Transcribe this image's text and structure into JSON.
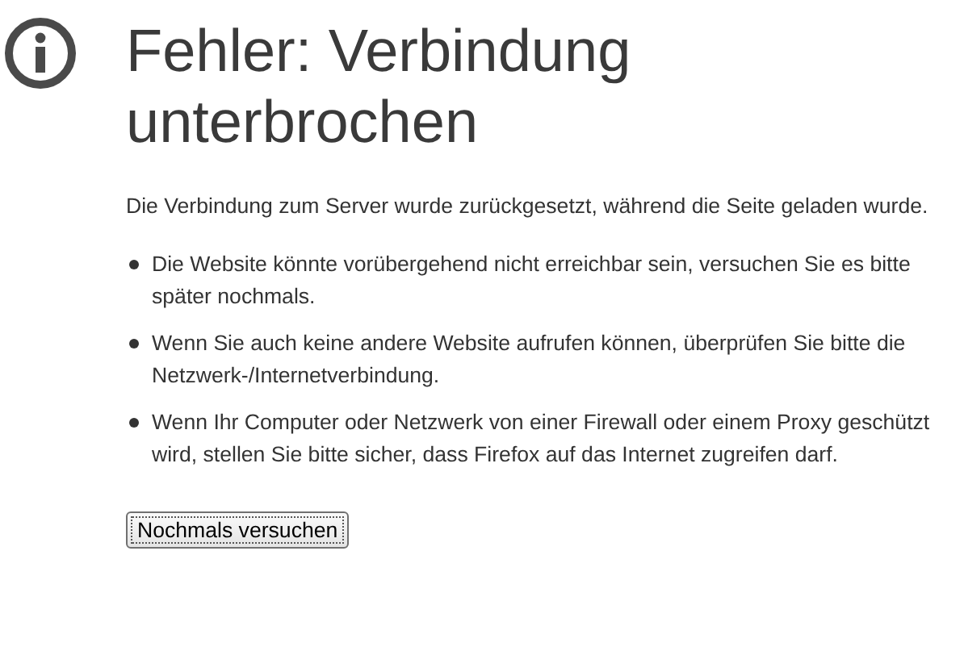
{
  "title": "Fehler: Verbindung unterbrochen",
  "message": "Die Verbindung zum Server wurde zurückgesetzt, während die Seite geladen wurde.",
  "hints": [
    "Die Website könnte vorübergehend nicht erreichbar sein, versuchen Sie es bitte später nochmals.",
    "Wenn Sie auch keine andere Website aufrufen können, überprüfen Sie bitte die Netzwerk-/Internetverbindung.",
    "Wenn Ihr Computer oder Netzwerk von einer Firewall oder einem Proxy geschützt wird, stellen Sie bitte sicher, dass Firefox auf das Internet zugreifen darf."
  ],
  "button": "Nochmals versuchen"
}
